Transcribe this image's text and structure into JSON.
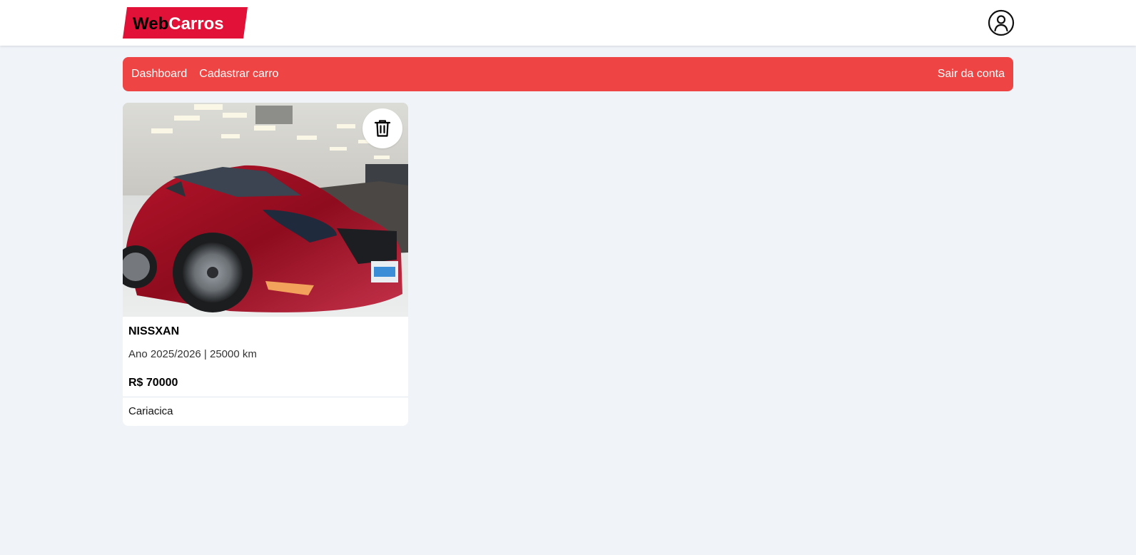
{
  "header": {
    "logo_prefix": "Web",
    "logo_suffix": "Carros",
    "brand_color": "#e11138",
    "profile_icon": "user-circle-icon"
  },
  "nav": {
    "items": [
      {
        "label": "Dashboard"
      },
      {
        "label": "Cadastrar carro"
      }
    ],
    "logout_label": "Sair da conta",
    "bg_color": "#ef4444"
  },
  "cars": [
    {
      "name": "NISSXAN",
      "details": "Ano 2025/2026 | 25000 km",
      "price": "R$ 70000",
      "city": "Cariacica",
      "image_icon": "red-sedan-photo",
      "delete_icon": "trash-icon"
    }
  ]
}
